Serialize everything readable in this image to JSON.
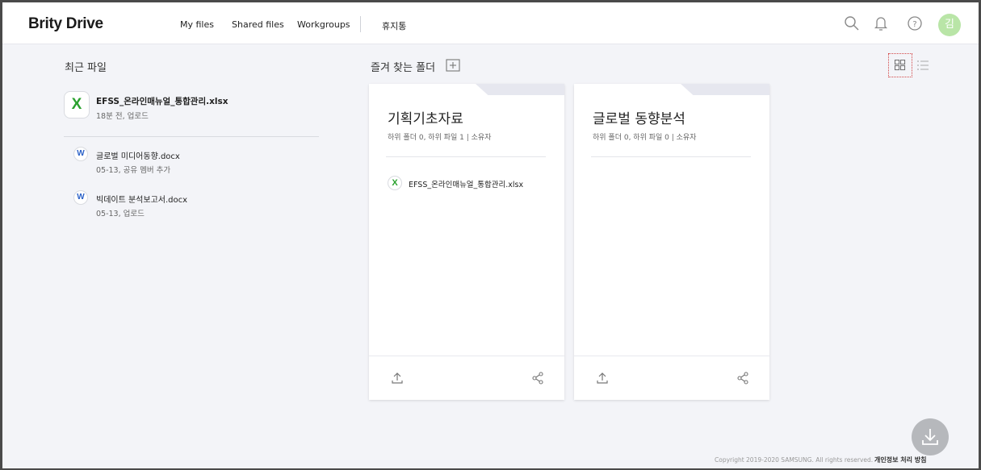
{
  "header": {
    "logo": "Brity Drive",
    "nav": [
      "My files",
      "Shared files",
      "Workgroups",
      "휴지통"
    ],
    "avatar_initial": "김"
  },
  "recent": {
    "title": "최근 파일",
    "main_file": {
      "name": "EFSS_온라인매뉴얼_통합관리.xlsx",
      "meta": "18분 전, 업로드",
      "icon_letter": "X"
    },
    "files": [
      {
        "name": "글로벌 미디어동향.docx",
        "meta": "05-13, 공유 멤버 추가",
        "icon_letter": "W"
      },
      {
        "name": "빅데이트 분석보고서.docx",
        "meta": "05-13, 업로드",
        "icon_letter": "W"
      }
    ]
  },
  "favorites": {
    "title": "즐겨 찾는 폴더",
    "folders": [
      {
        "title": "기획기초자료",
        "meta": "하위 폴더 0, 하위 파일 1 | 소유자",
        "files": [
          {
            "name": "EFSS_온라인매뉴얼_통합관리.xlsx",
            "icon_letter": "X"
          }
        ]
      },
      {
        "title": "글로벌 동향분석",
        "meta": "하위 폴더 0, 하위 파일 0 | 소유자",
        "files": []
      }
    ]
  },
  "footer": {
    "copyright": "Copyright 2019-2020 SAMSUNG. All rights reserved.",
    "privacy": "개인정보 처리 방침"
  },
  "colors": {
    "accent_green": "#2aa12f",
    "word_blue": "#2d62c8",
    "avatar_bg": "#b9e5a7",
    "page_bg": "#f3f4f8"
  }
}
